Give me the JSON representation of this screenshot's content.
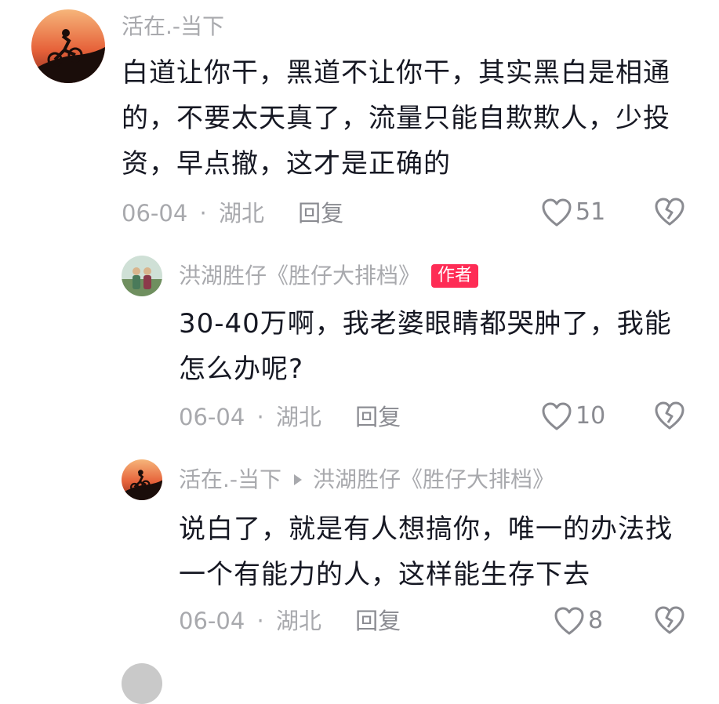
{
  "comments": [
    {
      "author": "活在.-当下",
      "text": "白道让你干，黑道不让你干，其实黑白是相通的，不要太天真了，流量只能自欺欺人，少投资，早点撤，这才是正确的",
      "date": "06-04",
      "location": "湖北",
      "reply_label": "回复",
      "likes": "51"
    },
    {
      "author": "洪湖胜仔《胜仔大排档》",
      "badge": "作者",
      "text": "30-40万啊，我老婆眼睛都哭肿了，我能怎么办呢?",
      "date": "06-04",
      "location": "湖北",
      "reply_label": "回复",
      "likes": "10"
    },
    {
      "author": "活在.-当下",
      "reply_to": "洪湖胜仔《胜仔大排档》",
      "text": "说白了，就是有人想搞你，唯一的办法找一个有能力的人，这样能生存下去",
      "date": "06-04",
      "location": "湖北",
      "reply_label": "回复",
      "likes": "8"
    }
  ],
  "separator": "·",
  "icons": {
    "like": "heart-outline-icon",
    "dislike": "broken-heart-icon"
  },
  "colors": {
    "author_badge": "#fe2c55",
    "meta_gray": "#a8a9ad"
  }
}
